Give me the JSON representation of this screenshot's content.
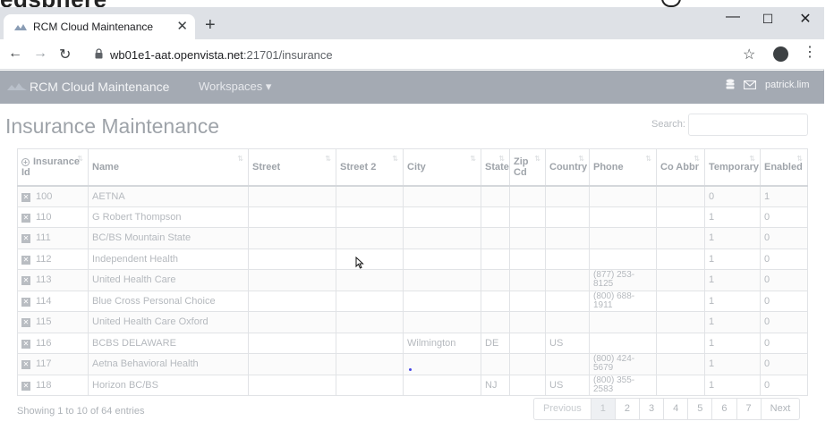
{
  "background_app": {
    "title": "edsphere"
  },
  "browser": {
    "tab_title": "RCM Cloud Maintenance",
    "url_host": "wb01e1-aat.openvista.net",
    "url_path": ":21701/insurance"
  },
  "app": {
    "brand": "RCM Cloud Maintenance",
    "workspaces_label": "Workspaces",
    "user": "patrick.lim"
  },
  "page": {
    "title": "Insurance Maintenance",
    "search_label": "Search:",
    "search_value": ""
  },
  "table": {
    "columns": [
      "Insurance Id",
      "Name",
      "Street",
      "Street 2",
      "City",
      "State",
      "Zip Cd",
      "Country",
      "Phone",
      "Co Abbr",
      "Temporary",
      "Enabled"
    ],
    "rows": [
      {
        "id": "100",
        "name": "AETNA",
        "street": "",
        "street2": "",
        "city": "",
        "state": "",
        "zip": "",
        "country": "",
        "phone": "",
        "abbr": "",
        "temporary": "0",
        "enabled": "1"
      },
      {
        "id": "110",
        "name": "G Robert Thompson",
        "street": "",
        "street2": "",
        "city": "",
        "state": "",
        "zip": "",
        "country": "",
        "phone": "",
        "abbr": "",
        "temporary": "1",
        "enabled": "0"
      },
      {
        "id": "111",
        "name": "BC/BS Mountain State",
        "street": "",
        "street2": "",
        "city": "",
        "state": "",
        "zip": "",
        "country": "",
        "phone": "",
        "abbr": "",
        "temporary": "1",
        "enabled": "0"
      },
      {
        "id": "112",
        "name": "Independent Health",
        "street": "",
        "street2": "",
        "city": "",
        "state": "",
        "zip": "",
        "country": "",
        "phone": "",
        "abbr": "",
        "temporary": "1",
        "enabled": "0"
      },
      {
        "id": "113",
        "name": "United Health Care",
        "street": "",
        "street2": "",
        "city": "",
        "state": "",
        "zip": "",
        "country": "",
        "phone": "(877) 253-8125",
        "abbr": "",
        "temporary": "1",
        "enabled": "0"
      },
      {
        "id": "114",
        "name": "Blue Cross Personal Choice",
        "street": "",
        "street2": "",
        "city": "",
        "state": "",
        "zip": "",
        "country": "",
        "phone": "(800) 688-1911",
        "abbr": "",
        "temporary": "1",
        "enabled": "0"
      },
      {
        "id": "115",
        "name": "United Health Care Oxford",
        "street": "",
        "street2": "",
        "city": "",
        "state": "",
        "zip": "",
        "country": "",
        "phone": "",
        "abbr": "",
        "temporary": "1",
        "enabled": "0"
      },
      {
        "id": "116",
        "name": "BCBS DELAWARE",
        "street": "",
        "street2": "",
        "city": "Wilmington",
        "state": "DE",
        "zip": "",
        "country": "US",
        "phone": "",
        "abbr": "",
        "temporary": "1",
        "enabled": "0"
      },
      {
        "id": "117",
        "name": "Aetna Behavioral Health",
        "street": "",
        "street2": "",
        "city": "",
        "state": "",
        "zip": "",
        "country": "",
        "phone": "(800) 424-5679",
        "abbr": "",
        "temporary": "1",
        "enabled": "0"
      },
      {
        "id": "118",
        "name": "Horizon BC/BS",
        "street": "",
        "street2": "",
        "city": "",
        "state": "NJ",
        "zip": "",
        "country": "US",
        "phone": "(800) 355-2583",
        "abbr": "",
        "temporary": "1",
        "enabled": "0"
      }
    ]
  },
  "footer": {
    "info": "Showing 1 to 10 of 64 entries",
    "pagination": [
      "Previous",
      "1",
      "2",
      "3",
      "4",
      "5",
      "6",
      "7",
      "Next"
    ],
    "active_page": "1"
  }
}
